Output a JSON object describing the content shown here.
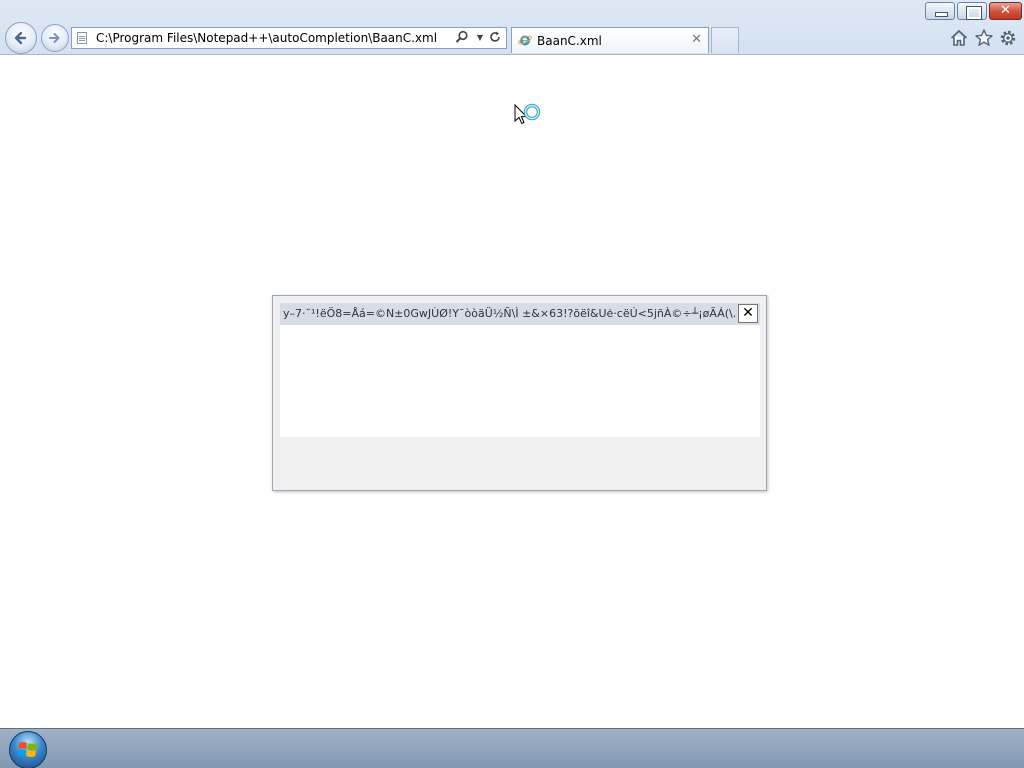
{
  "browser": {
    "address": "C:\\Program Files\\Notepad++\\autoCompletion\\BaanC.xml",
    "tab_title": "BaanC.xml",
    "tab_close": "✕",
    "icons": {
      "back": "back-arrow-icon",
      "forward": "forward-arrow-icon",
      "search": "search-icon",
      "refresh": "refresh-icon",
      "home": "home-icon",
      "favorites": "star-icon",
      "tools": "gear-icon",
      "tab": "ie-page-icon"
    }
  },
  "window_controls": {
    "close_glyph": "✕"
  },
  "dialog": {
    "title": "y–7·˘¹!ëÖ8=Åá=©N±0GwJÙØ!Y¯òòäÜ½Ñ\\Ì ±&×63!?õëî&Uė·cëÚ<5jñÀ©÷┴¡øÃÁ(\\...",
    "close_glyph": "✕"
  },
  "taskbar": {
    "start_icon": "windows-logo-icon"
  },
  "colors": {
    "chrome_bg": "#d3e1f1",
    "taskbar_bg": "#8297b1",
    "dialog_header": "#d7dde5",
    "close_red": "#d2553d"
  }
}
